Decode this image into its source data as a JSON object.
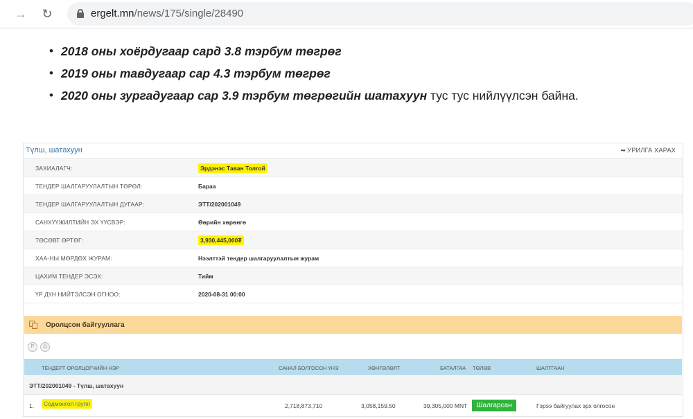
{
  "browser": {
    "url_host": "ergelt.mn",
    "url_path": "/news/175/single/28490"
  },
  "article": {
    "bullets": [
      {
        "bold": "2018 оны хоёрдугаар сард 3.8 тэрбум төгрөг",
        "rest": ""
      },
      {
        "bold": "2019 оны тавдугаар сар 4.3 тэрбум төгрөг",
        "rest": ""
      },
      {
        "bold": "2020 оны зургадугаар сар 3.9 тэрбум төгрөгийн шатахуун",
        "rest": " тус тус нийлүүлсэн байна."
      }
    ]
  },
  "panel": {
    "title": "Түлш, шатахуун",
    "action_label": "УРИЛГА ХАРАХ",
    "info": [
      {
        "label": "ЗАХИАЛАГЧ:",
        "value": "Эрдэнэс Таван Толгой"
      },
      {
        "label": "ТЕНДЕР ШАЛГАРУУЛАЛТЫН ТӨРӨЛ:",
        "value": "Бараа"
      },
      {
        "label": "ТЕНДЕР ШАЛГАРУУЛАЛТЫН ДУГААР:",
        "value": "ЭТТ/202001049"
      },
      {
        "label": "САНХҮҮЖИЛТИЙН ЭХ ҮҮСВЭР:",
        "value": "Өөрийн хөрөнгө"
      },
      {
        "label": "ТӨСӨВТ ӨРТӨГ:",
        "value": "3,930,445,000₮"
      },
      {
        "label": "ХАА-НЫ МӨРДӨХ ЖУРАМ:",
        "value": "Нээлттэй тендер шалгаруулалтын журам"
      },
      {
        "label": "ЦАХИМ ТЕНДЕР ЭСЭХ:",
        "value": "Тийм"
      },
      {
        "label": "ҮР ДҮН НИЙТЭЛСЭН ОГНОО:",
        "value": "2020-08-31 00:00"
      }
    ],
    "orgs_title": "Оролцсон байгууллага",
    "mini_buttons": [
      "P",
      "⎙"
    ],
    "columns": {
      "name": "ТЕНДЕРТ ОРОЛЦОГЧИЙН НЭР",
      "bid": "САНАЛ БОЛГОСОН ҮНЭ",
      "discount": "ХӨНГӨЛӨЛТ",
      "guarantee": "БАТАЛГАА",
      "payment": "ТӨЛӨВ",
      "reason": "ШАЛТГААН"
    },
    "group_label": "ЭТТ/202001049 - Түлш, шатахуун",
    "rows": [
      {
        "index": "1.",
        "name": "Содмонгол групп",
        "bid": "2,718,873,710",
        "discount": "3,058,159.50",
        "guarantee": "39,305,000 MNT",
        "status": "Шалгарсан",
        "reason": "Гэрээ байгуулах эрх олгосон"
      }
    ]
  },
  "colors": {
    "highlight": "#fff200",
    "orgs_bar": "#fad99a",
    "grid_head": "#b6dcee",
    "status_green": "#30b33b",
    "link_blue": "#3a72a8"
  }
}
